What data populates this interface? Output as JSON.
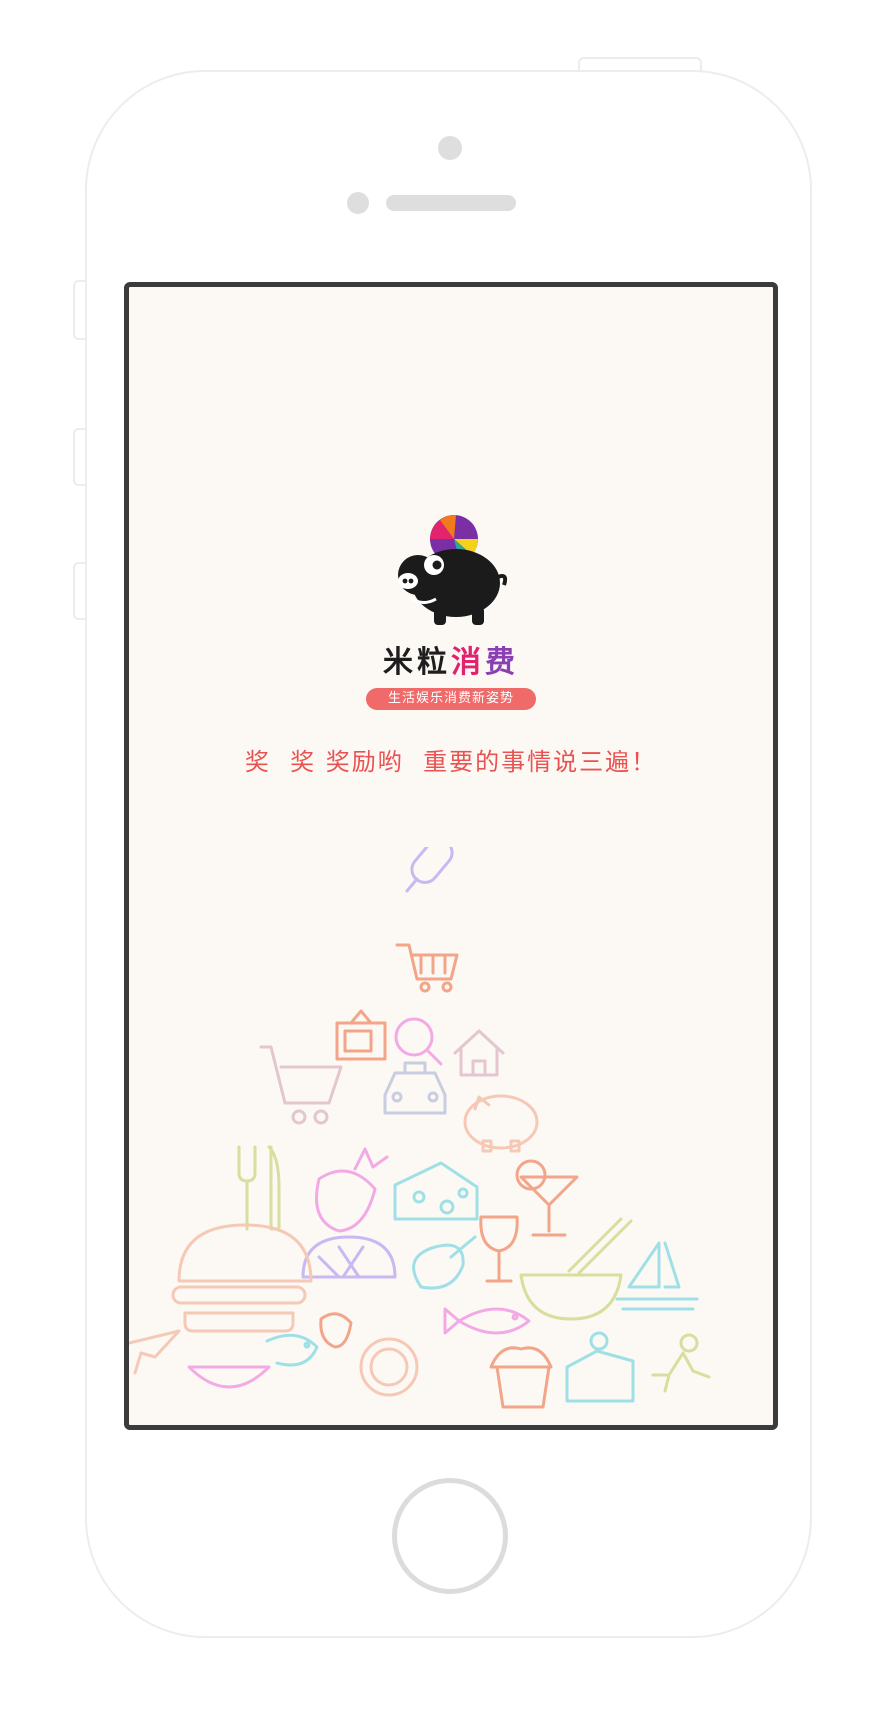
{
  "splash": {
    "brand_name_parts": [
      "米",
      "粒",
      "消",
      "费"
    ],
    "tagline": "生活娱乐消费新姿势",
    "headline": "奖  奖 奖励哟  重要的事情说三遍！"
  },
  "icons": {
    "mascot": "piggy-bank-mascot-icon",
    "illustration": [
      "popsicle",
      "shopping-basket",
      "tv",
      "magnifier",
      "shopping-cart",
      "house",
      "taxi",
      "piggy-bank",
      "fork-knife",
      "strawberry",
      "cheese",
      "cocktail",
      "bread",
      "drumstick",
      "wine-glass",
      "noodle-bowl",
      "sailboat",
      "burger",
      "fish",
      "shrimp",
      "airplane",
      "cake",
      "runner"
    ]
  },
  "colors": {
    "screen_bg": "#fcf9f4",
    "accent_red": "#ea5252",
    "tagline_bg": "#f06a6a",
    "bezel": "#3b3b3b"
  }
}
